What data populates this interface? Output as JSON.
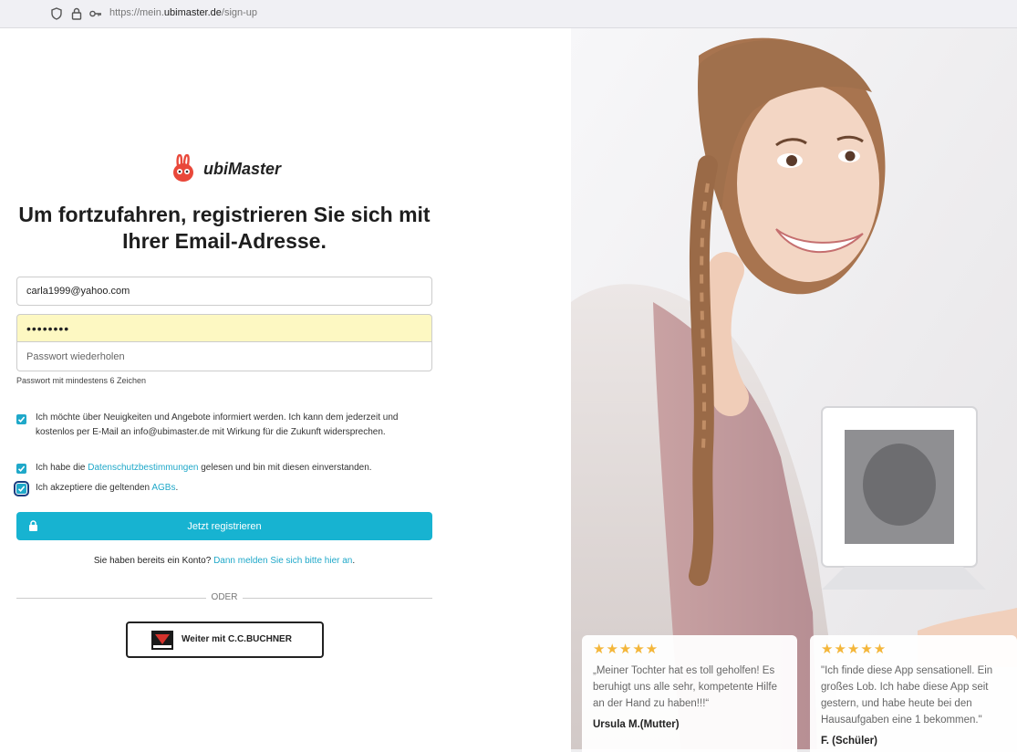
{
  "browser": {
    "url_prefix": "https://mein.",
    "url_domain": "ubimaster.de",
    "url_path": "/sign-up"
  },
  "brand": {
    "name": "ubiMaster",
    "color": "#e9483a"
  },
  "heading": "Um fortzufahren, registrieren Sie sich mit Ihrer Email-Adresse.",
  "form": {
    "email_value": "carla1999@yahoo.com",
    "password_value": "xxxxxxxx",
    "repeat_placeholder": "Passwort wiederholen",
    "password_hint": "Passwort mit mindestens 6 Zeichen"
  },
  "checkboxes": [
    {
      "checked": true,
      "text": "Ich möchte über Neuigkeiten und Angebote informiert werden. Ich kann dem jederzeit und kostenlos per E-Mail an info@ubimaster.de mit Wirkung für die Zukunft widersprechen."
    },
    {
      "checked": true,
      "pre": "Ich habe die ",
      "link": "Datenschutzbestimmungen",
      "post": " gelesen und bin mit diesen einverstanden."
    },
    {
      "checked": true,
      "pre": "Ich akzeptiere die geltenden ",
      "link": "AGBs",
      "post": "."
    }
  ],
  "register_button": "Jetzt registrieren",
  "login_prompt": {
    "text": "Sie haben bereits ein Konto? ",
    "link": "Dann melden Sie sich bitte hier an",
    "post": "."
  },
  "divider_text": "ODER",
  "ccbuchner_button": "Weiter mit C.C.BUCHNER",
  "colors": {
    "accent": "#17b3d1",
    "star": "#f4b63a"
  },
  "testimonials": [
    {
      "stars": "★★★★★",
      "rating": 5,
      "quote": "„Meiner Tochter hat es toll geholfen! Es beruhigt uns alle sehr, kompetente Hilfe an der Hand zu haben!!!“",
      "author": "Ursula M.(Mutter)"
    },
    {
      "stars": "★★★★★",
      "rating": 5,
      "quote": "\"Ich finde diese App sensationell. Ein großes Lob. Ich habe diese App seit gestern, und habe heute bei den Hausaufgaben eine 1 bekommen.\"",
      "author": "F. (Schüler)"
    }
  ]
}
